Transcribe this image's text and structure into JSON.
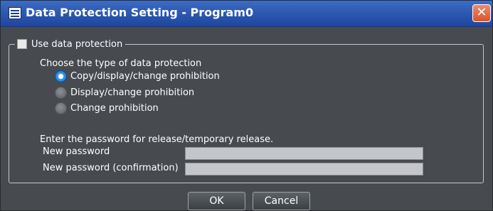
{
  "window": {
    "title": "Data Protection Setting - Program0",
    "app_icon": "window-icon",
    "close_icon": "close-icon",
    "close_glyph": "✕"
  },
  "protection": {
    "use_label": "Use data protection",
    "use_checked": false,
    "type_heading": "Choose the type of data protection",
    "options": [
      {
        "label": "Copy/display/change prohibition",
        "selected": true
      },
      {
        "label": "Display/change prohibition",
        "selected": false
      },
      {
        "label": "Change prohibition",
        "selected": false
      }
    ]
  },
  "password": {
    "instruction": "Enter the password for release/temporary release.",
    "new_label": "New password",
    "new_value": "",
    "confirm_label": "New password (confirmation)",
    "confirm_value": ""
  },
  "buttons": {
    "ok": "OK",
    "cancel": "Cancel"
  },
  "colors": {
    "titlebar": "#2d5ab0",
    "background": "#474b50",
    "close": "#d8532d",
    "radio_selected": "#1b78d0"
  }
}
